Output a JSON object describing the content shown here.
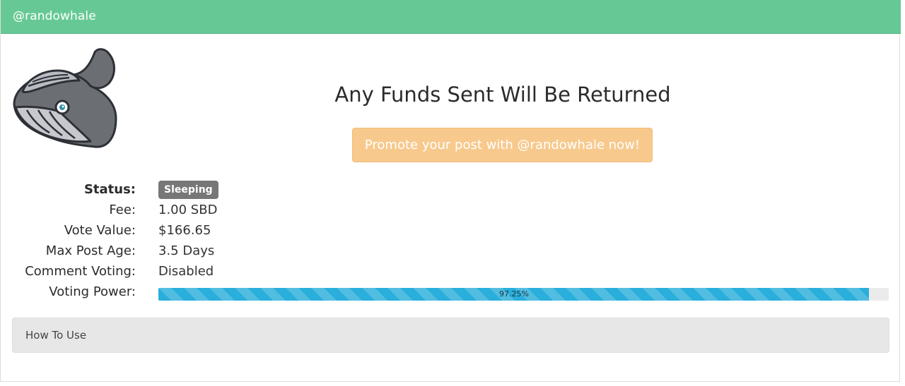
{
  "header": {
    "title": "@randowhale"
  },
  "logo": {
    "icon": "whale-logo-icon"
  },
  "main": {
    "headline": "Any Funds Sent Will Be Returned",
    "promo_button_label": "Promote your post with @randowhale now!"
  },
  "stats": {
    "status_label": "Status:",
    "status_value": "Sleeping",
    "fee_label": "Fee:",
    "fee_value": "1.00 SBD",
    "vote_value_label": "Vote Value:",
    "vote_value": "$166.65",
    "max_post_age_label": "Max Post Age:",
    "max_post_age_value": "3.5 Days",
    "comment_voting_label": "Comment Voting:",
    "comment_voting_value": "Disabled",
    "voting_power_label": "Voting Power:",
    "voting_power_text": "97.25%",
    "voting_power_fraction": 0.9725
  },
  "howto": {
    "label": "How To Use"
  },
  "colors": {
    "header_bg": "#66c995",
    "button_bg": "#f8c98d",
    "badge_bg": "#777777",
    "progress_bar": "#2aaedb"
  }
}
